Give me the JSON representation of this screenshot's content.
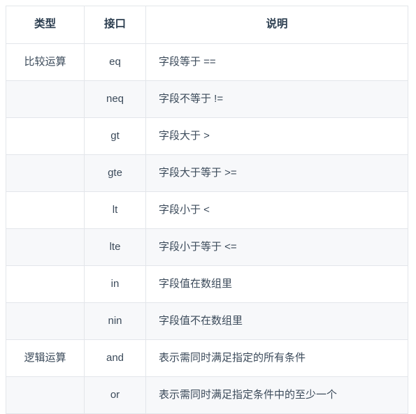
{
  "table": {
    "columns": [
      {
        "key": "type",
        "label": "类型",
        "align": "center"
      },
      {
        "key": "api",
        "label": "接口",
        "align": "center"
      },
      {
        "key": "desc",
        "label": "说明",
        "align": "center"
      }
    ],
    "rows": [
      {
        "type": "比较运算",
        "api": "eq",
        "desc": "字段等于 =="
      },
      {
        "type": "",
        "api": "neq",
        "desc": "字段不等于 !="
      },
      {
        "type": "",
        "api": "gt",
        "desc": "字段大于 >"
      },
      {
        "type": "",
        "api": "gte",
        "desc": "字段大于等于 >="
      },
      {
        "type": "",
        "api": "lt",
        "desc": "字段小于 <"
      },
      {
        "type": "",
        "api": "lte",
        "desc": "字段小于等于 <="
      },
      {
        "type": "",
        "api": "in",
        "desc": "字段值在数组里"
      },
      {
        "type": "",
        "api": "nin",
        "desc": "字段值不在数组里"
      },
      {
        "type": "逻辑运算",
        "api": "and",
        "desc": "表示需同时满足指定的所有条件"
      },
      {
        "type": "",
        "api": "or",
        "desc": "表示需同时满足指定条件中的至少一个"
      }
    ]
  },
  "colors": {
    "border": "#e3e6ea",
    "row_alt_bg": "#f7f8fa",
    "row_bg": "#ffffff",
    "text": "#3b4a5a",
    "header_text": "#2c3e50"
  }
}
